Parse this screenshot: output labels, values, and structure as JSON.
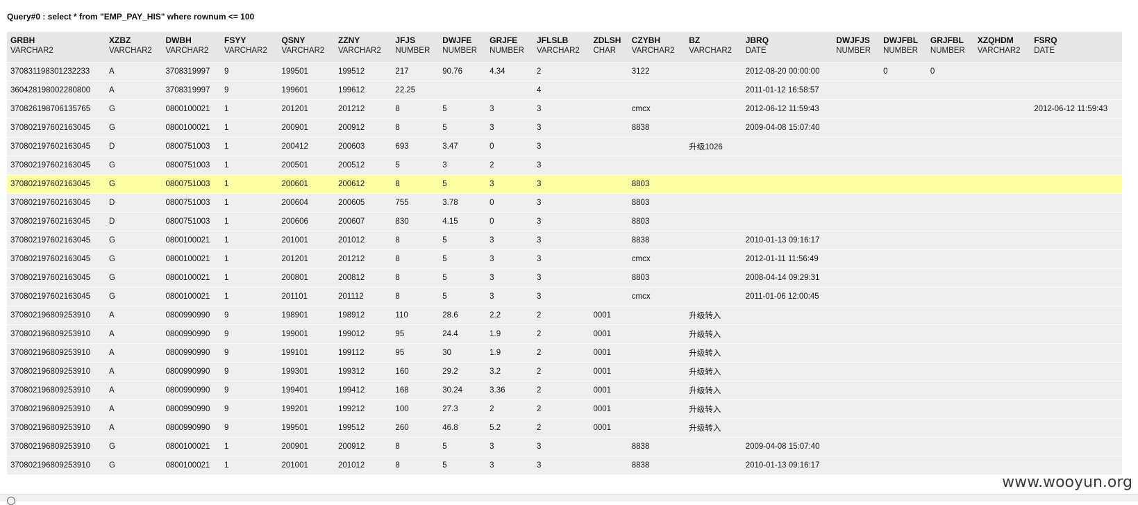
{
  "query": {
    "title": "Query#0 : select * from \"EMP_PAY_HIS\" where rownum <= 100"
  },
  "columns": [
    {
      "name": "GRBH",
      "type": "VARCHAR2"
    },
    {
      "name": "XZBZ",
      "type": "VARCHAR2"
    },
    {
      "name": "DWBH",
      "type": "VARCHAR2"
    },
    {
      "name": "FSYY",
      "type": "VARCHAR2"
    },
    {
      "name": "QSNY",
      "type": "VARCHAR2"
    },
    {
      "name": "ZZNY",
      "type": "VARCHAR2"
    },
    {
      "name": "JFJS",
      "type": "NUMBER"
    },
    {
      "name": "DWJFE",
      "type": "NUMBER"
    },
    {
      "name": "GRJFE",
      "type": "NUMBER"
    },
    {
      "name": "JFLSLB",
      "type": "VARCHAR2"
    },
    {
      "name": "ZDLSH",
      "type": "CHAR"
    },
    {
      "name": "CZYBH",
      "type": "VARCHAR2"
    },
    {
      "name": "BZ",
      "type": "VARCHAR2"
    },
    {
      "name": "JBRQ",
      "type": "DATE"
    },
    {
      "name": "DWJFJS",
      "type": "NUMBER"
    },
    {
      "name": "DWJFBL",
      "type": "NUMBER"
    },
    {
      "name": "GRJFBL",
      "type": "NUMBER"
    },
    {
      "name": "XZQHDM",
      "type": "VARCHAR2"
    },
    {
      "name": "FSRQ",
      "type": "DATE"
    }
  ],
  "rows": [
    [
      "370831198301232233",
      "A",
      "3708319997",
      "9",
      "199501",
      "199512",
      "217",
      "90.76",
      "4.34",
      "2",
      "",
      "3122",
      "",
      "2012-08-20 00:00:00",
      "",
      "0",
      "0",
      "",
      ""
    ],
    [
      "360428198002280800",
      "A",
      "3708319997",
      "9",
      "199601",
      "199612",
      "22.25",
      "",
      "",
      "4",
      "",
      "",
      "",
      "2011-01-12 16:58:57",
      "",
      "",
      "",
      "",
      ""
    ],
    [
      "370826198706135765",
      "G",
      "0800100021",
      "1",
      "201201",
      "201212",
      "8",
      "5",
      "3",
      "3",
      "",
      "cmcx",
      "",
      "2012-06-12 11:59:43",
      "",
      "",
      "",
      "",
      "2012-06-12 11:59:43"
    ],
    [
      "370802197602163045",
      "G",
      "0800100021",
      "1",
      "200901",
      "200912",
      "8",
      "5",
      "3",
      "3",
      "",
      "8838",
      "",
      "2009-04-08 15:07:40",
      "",
      "",
      "",
      "",
      ""
    ],
    [
      "370802197602163045",
      "D",
      "0800751003",
      "1",
      "200412",
      "200603",
      "693",
      "3.47",
      "0",
      "3",
      "",
      "",
      "升级1026",
      "",
      "",
      "",
      "",
      "",
      ""
    ],
    [
      "370802197602163045",
      "G",
      "0800751003",
      "1",
      "200501",
      "200512",
      "5",
      "3",
      "2",
      "3",
      "",
      "",
      "",
      "",
      "",
      "",
      "",
      "",
      ""
    ],
    [
      "370802197602163045",
      "G",
      "0800751003",
      "1",
      "200601",
      "200612",
      "8",
      "5",
      "3",
      "3",
      "",
      "8803",
      "",
      "",
      "",
      "",
      "",
      "",
      ""
    ],
    [
      "370802197602163045",
      "D",
      "0800751003",
      "1",
      "200604",
      "200605",
      "755",
      "3.78",
      "0",
      "3",
      "",
      "8803",
      "",
      "",
      "",
      "",
      "",
      "",
      ""
    ],
    [
      "370802197602163045",
      "D",
      "0800751003",
      "1",
      "200606",
      "200607",
      "830",
      "4.15",
      "0",
      "3",
      "",
      "8803",
      "",
      "",
      "",
      "",
      "",
      "",
      ""
    ],
    [
      "370802197602163045",
      "G",
      "0800100021",
      "1",
      "201001",
      "201012",
      "8",
      "5",
      "3",
      "3",
      "",
      "8838",
      "",
      "2010-01-13 09:16:17",
      "",
      "",
      "",
      "",
      ""
    ],
    [
      "370802197602163045",
      "G",
      "0800100021",
      "1",
      "201201",
      "201212",
      "8",
      "5",
      "3",
      "3",
      "",
      "cmcx",
      "",
      "2012-01-11 11:56:49",
      "",
      "",
      "",
      "",
      ""
    ],
    [
      "370802197602163045",
      "G",
      "0800100021",
      "1",
      "200801",
      "200812",
      "8",
      "5",
      "3",
      "3",
      "",
      "8803",
      "",
      "2008-04-14 09:29:31",
      "",
      "",
      "",
      "",
      ""
    ],
    [
      "370802197602163045",
      "G",
      "0800100021",
      "1",
      "201101",
      "201112",
      "8",
      "5",
      "3",
      "3",
      "",
      "cmcx",
      "",
      "2011-01-06 12:00:45",
      "",
      "",
      "",
      "",
      ""
    ],
    [
      "370802196809253910",
      "A",
      "0800990990",
      "9",
      "198901",
      "198912",
      "110",
      "28.6",
      "2.2",
      "2",
      "0001",
      "",
      "升级转入",
      "",
      "",
      "",
      "",
      "",
      ""
    ],
    [
      "370802196809253910",
      "A",
      "0800990990",
      "9",
      "199001",
      "199012",
      "95",
      "24.4",
      "1.9",
      "2",
      "0001",
      "",
      "升级转入",
      "",
      "",
      "",
      "",
      "",
      ""
    ],
    [
      "370802196809253910",
      "A",
      "0800990990",
      "9",
      "199101",
      "199112",
      "95",
      "30",
      "1.9",
      "2",
      "0001",
      "",
      "升级转入",
      "",
      "",
      "",
      "",
      "",
      ""
    ],
    [
      "370802196809253910",
      "A",
      "0800990990",
      "9",
      "199301",
      "199312",
      "160",
      "29.2",
      "3.2",
      "2",
      "0001",
      "",
      "升级转入",
      "",
      "",
      "",
      "",
      "",
      ""
    ],
    [
      "370802196809253910",
      "A",
      "0800990990",
      "9",
      "199401",
      "199412",
      "168",
      "30.24",
      "3.36",
      "2",
      "0001",
      "",
      "升级转入",
      "",
      "",
      "",
      "",
      "",
      ""
    ],
    [
      "370802196809253910",
      "A",
      "0800990990",
      "9",
      "199201",
      "199212",
      "100",
      "27.3",
      "2",
      "2",
      "0001",
      "",
      "升级转入",
      "",
      "",
      "",
      "",
      "",
      ""
    ],
    [
      "370802196809253910",
      "A",
      "0800990990",
      "9",
      "199501",
      "199512",
      "260",
      "46.8",
      "5.2",
      "2",
      "0001",
      "",
      "升级转入",
      "",
      "",
      "",
      "",
      "",
      ""
    ],
    [
      "370802196809253910",
      "G",
      "0800100021",
      "1",
      "200901",
      "200912",
      "8",
      "5",
      "3",
      "3",
      "",
      "8838",
      "",
      "2009-04-08 15:07:40",
      "",
      "",
      "",
      "",
      ""
    ],
    [
      "370802196809253910",
      "G",
      "0800100021",
      "1",
      "201001",
      "201012",
      "8",
      "5",
      "3",
      "3",
      "",
      "8838",
      "",
      "2010-01-13 09:16:17",
      "",
      "",
      "",
      "",
      ""
    ]
  ],
  "selected_row_index": 6,
  "watermark": {
    "text": "www.wooyun.org"
  },
  "colors": {
    "header_bg": "#e6e6e6",
    "row_bg": "#efefef",
    "selected_bg": "#fefea3"
  }
}
